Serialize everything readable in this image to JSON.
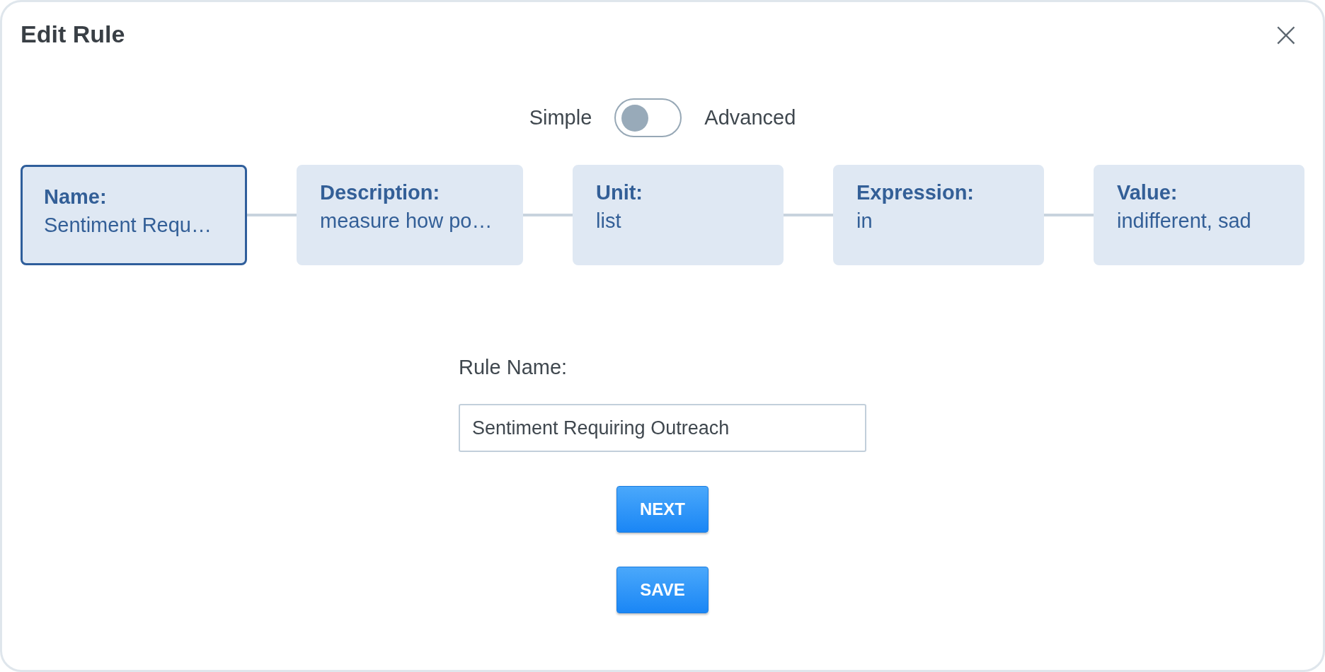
{
  "dialog": {
    "title": "Edit Rule",
    "close": "×"
  },
  "mode_toggle": {
    "left_label": "Simple",
    "right_label": "Advanced",
    "on": false
  },
  "steps": [
    {
      "label": "Name:",
      "value": "Sentiment Requ…",
      "selected": true
    },
    {
      "label": "Description:",
      "value": "measure how po…",
      "selected": false
    },
    {
      "label": "Unit:",
      "value": "list",
      "selected": false
    },
    {
      "label": "Expression:",
      "value": "in",
      "selected": false
    },
    {
      "label": "Value:",
      "value": "indifferent, sad",
      "selected": false
    }
  ],
  "form": {
    "label": "Rule Name:",
    "value": "Sentiment Requiring Outreach"
  },
  "buttons": [
    "NEXT",
    "SAVE"
  ]
}
